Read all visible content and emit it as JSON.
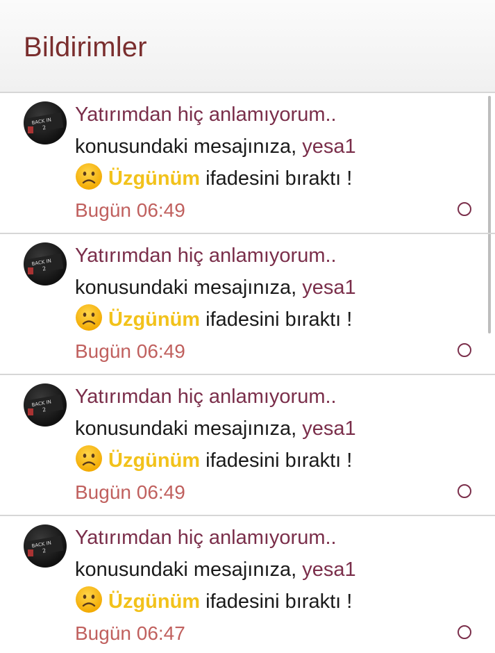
{
  "header": {
    "title": "Bildirimler"
  },
  "notifications": [
    {
      "thread": "Yatırımdan hiç anlamıyorum..",
      "message_prefix": "konusundaki mesajınıza, ",
      "user": "yesa1",
      "reaction_icon": "sad-face-icon",
      "reaction": "Üzgünüm",
      "suffix": " ifadesini bıraktı !",
      "time": "Bugün 06:49"
    },
    {
      "thread": "Yatırımdan hiç anlamıyorum..",
      "message_prefix": "konusundaki mesajınıza, ",
      "user": "yesa1",
      "reaction_icon": "sad-face-icon",
      "reaction": "Üzgünüm",
      "suffix": " ifadesini bıraktı !",
      "time": "Bugün 06:49"
    },
    {
      "thread": "Yatırımdan hiç anlamıyorum..",
      "message_prefix": "konusundaki mesajınıza, ",
      "user": "yesa1",
      "reaction_icon": "sad-face-icon",
      "reaction": "Üzgünüm",
      "suffix": " ifadesini bıraktı !",
      "time": "Bugün 06:49"
    },
    {
      "thread": "Yatırımdan hiç anlamıyorum..",
      "message_prefix": "konusundaki mesajınıza, ",
      "user": "yesa1",
      "reaction_icon": "sad-face-icon",
      "reaction": "Üzgünüm",
      "suffix": " ifadesini bıraktı !",
      "time": "Bugün 06:47"
    }
  ],
  "colors": {
    "title": "#7a2e2e",
    "thread_link": "#7a2e4a",
    "reaction": "#f2c21b",
    "time": "#c0605e"
  }
}
